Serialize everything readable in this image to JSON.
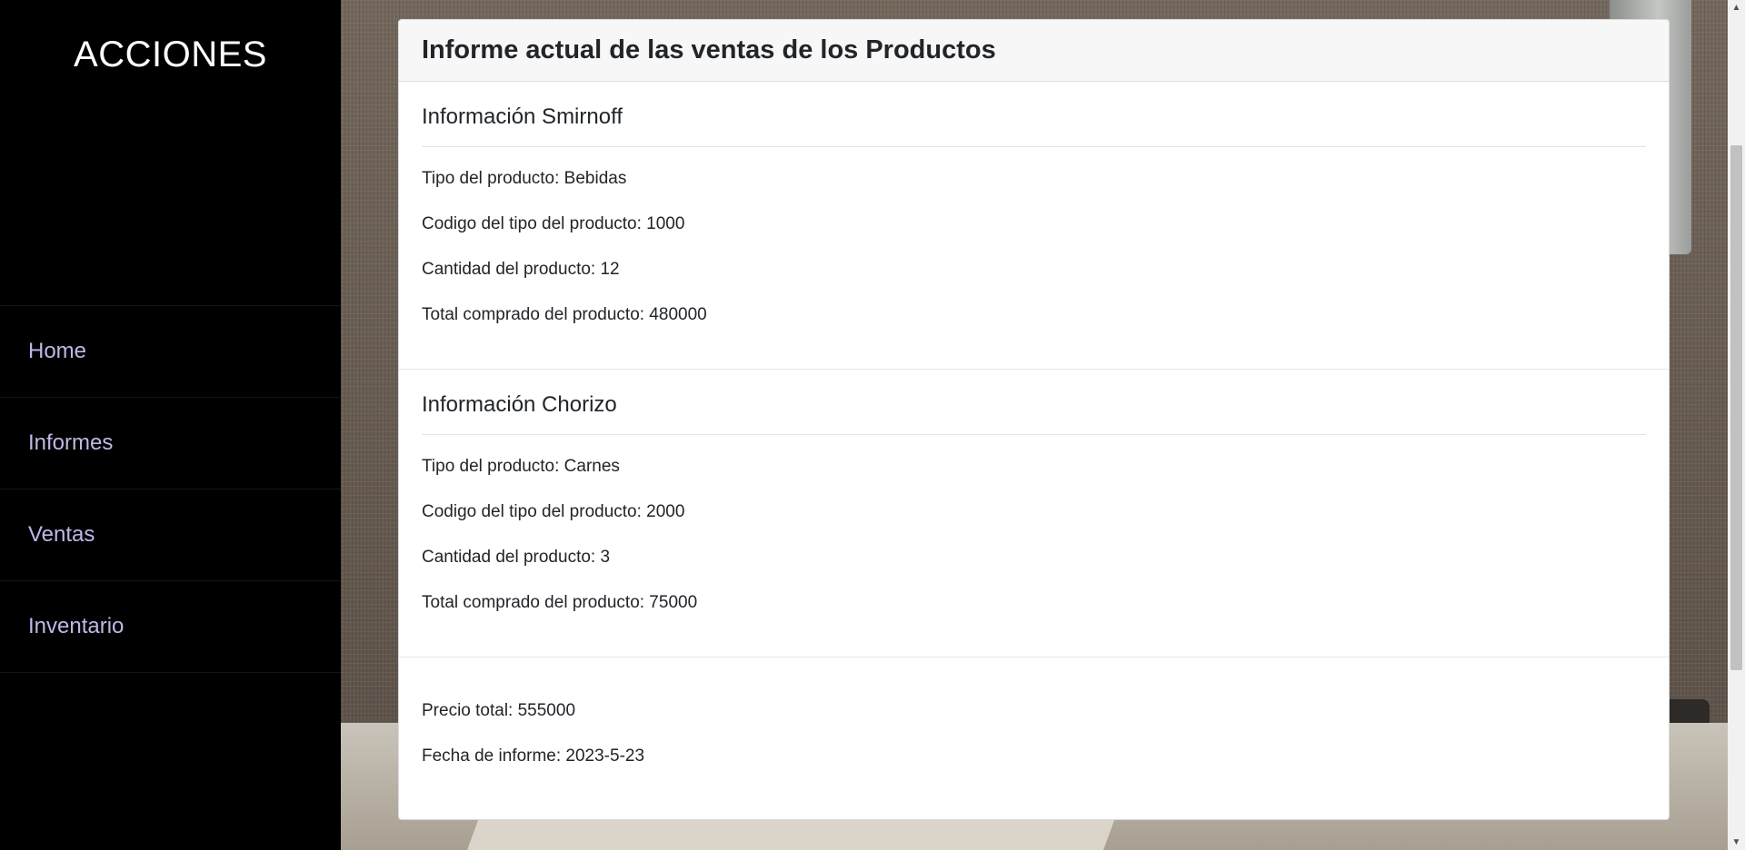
{
  "sidebar": {
    "title": "ACCIONES",
    "items": [
      {
        "label": "Home"
      },
      {
        "label": "Informes"
      },
      {
        "label": "Ventas"
      },
      {
        "label": "Inventario"
      }
    ]
  },
  "report": {
    "title": "Informe actual de las ventas de los Productos",
    "products": [
      {
        "heading": "Información Smirnoff",
        "type": "Tipo del producto: Bebidas",
        "code": "Codigo del tipo del producto: 1000",
        "quantity": "Cantidad del producto: 12",
        "total": "Total comprado del producto: 480000"
      },
      {
        "heading": "Información Chorizo",
        "type": "Tipo del producto: Carnes",
        "code": "Codigo del tipo del producto: 2000",
        "quantity": "Cantidad del producto: 3",
        "total": "Total comprado del producto: 75000"
      }
    ],
    "summary": {
      "total_price": "Precio total: 555000",
      "date": "Fecha de informe: 2023-5-23"
    }
  },
  "scrollbar": {
    "up_arrow": "▲",
    "down_arrow": "▼"
  }
}
